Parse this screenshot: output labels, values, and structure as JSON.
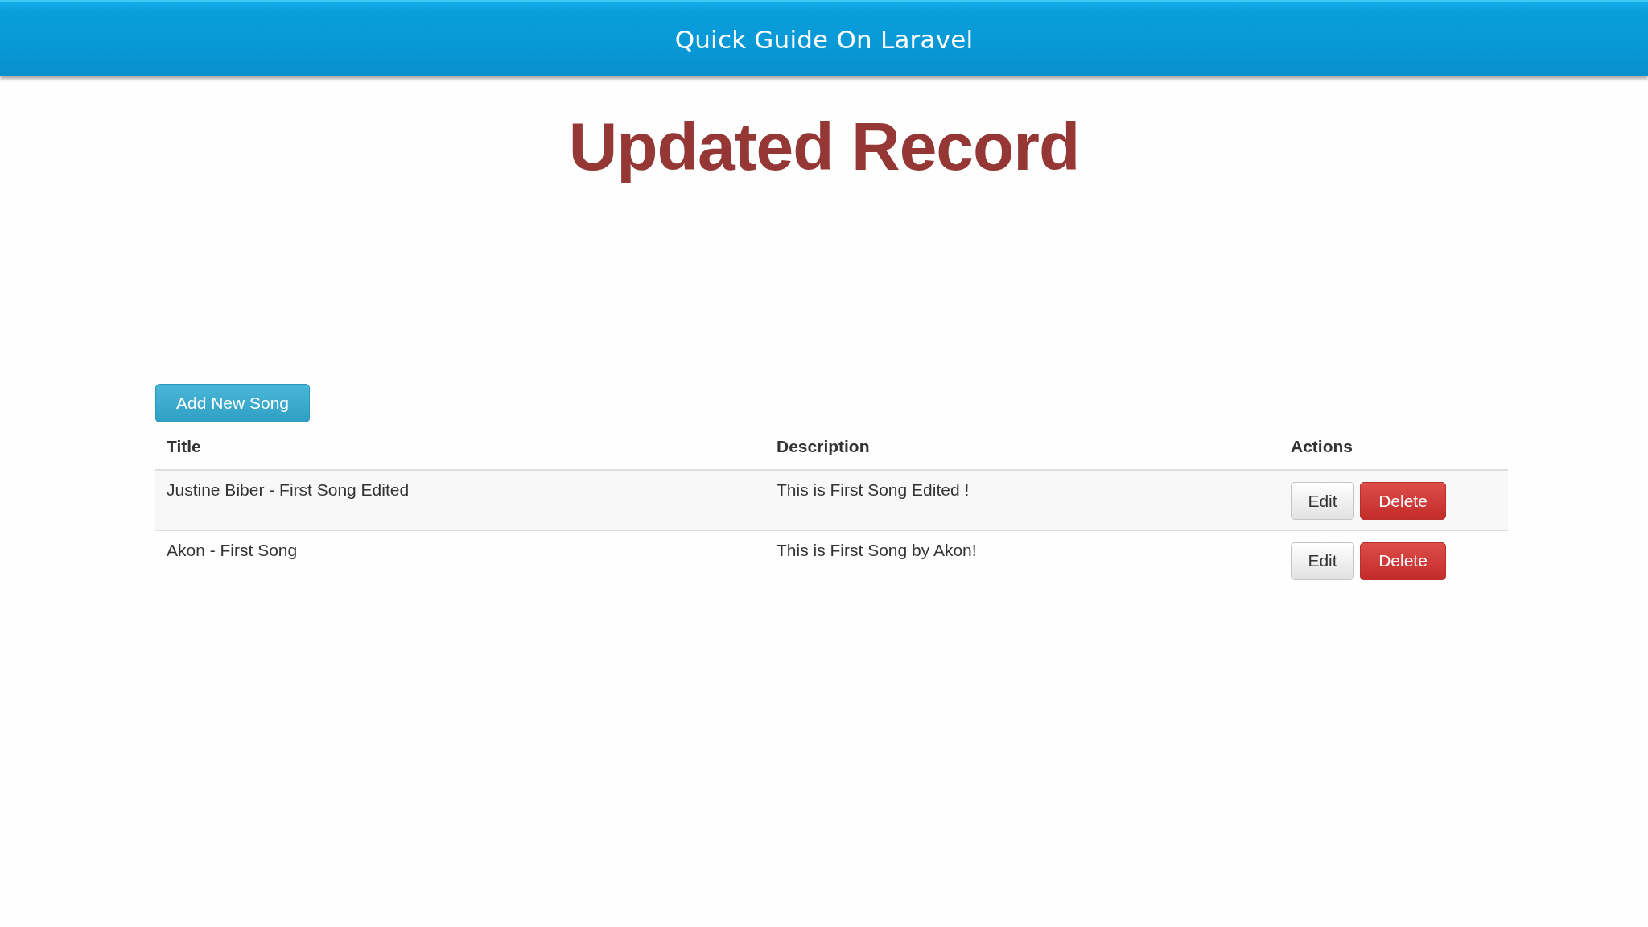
{
  "header": {
    "title": "Quick Guide On Laravel"
  },
  "heading": "Updated Record",
  "add_button": {
    "label": "Add New Song"
  },
  "table": {
    "columns": [
      "Title",
      "Description",
      "Actions"
    ],
    "rows": [
      {
        "title": "Justine Biber - First Song Edited",
        "description": "This is First Song Edited !",
        "actions": [
          {
            "label": "Edit",
            "kind": "default"
          },
          {
            "label": "Delete",
            "kind": "danger"
          }
        ]
      },
      {
        "title": "Akon - First Song",
        "description": "This is First Song by Akon!",
        "actions": [
          {
            "label": "Edit",
            "kind": "default"
          },
          {
            "label": "Delete",
            "kind": "danger"
          }
        ]
      }
    ]
  }
}
